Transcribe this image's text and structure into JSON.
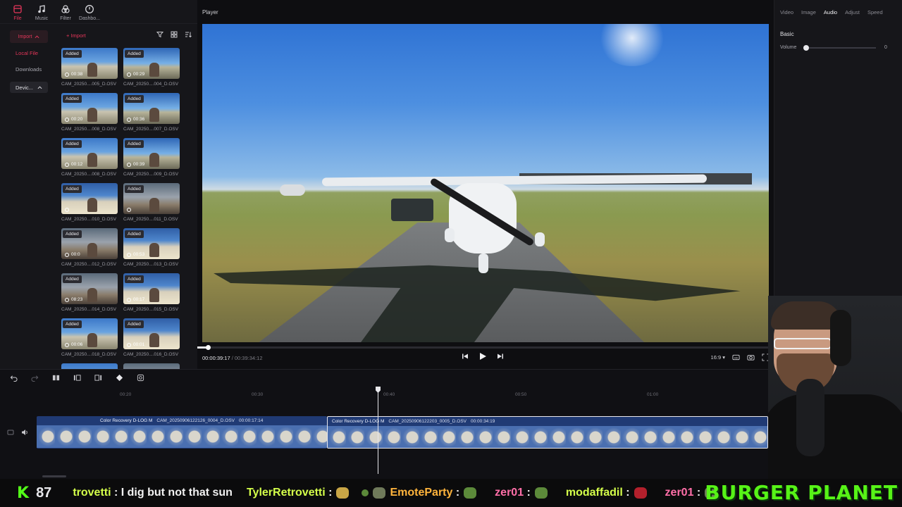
{
  "nav": {
    "items": [
      {
        "label": "File",
        "icon": "file-icon",
        "active": true
      },
      {
        "label": "Music",
        "icon": "music-note-icon",
        "active": false
      },
      {
        "label": "Filter",
        "icon": "filter-circles-icon",
        "active": false
      },
      {
        "label": "Dashbo...",
        "icon": "dashboard-clock-icon",
        "active": false
      }
    ]
  },
  "rail": {
    "import_label": "Import",
    "local_file": "Local File",
    "downloads": "Downloads",
    "devices": "Devic..."
  },
  "media": {
    "import_label": "+ Import",
    "clips": [
      {
        "badge": "Added",
        "duration": "00:38",
        "name": "CAM_20250....005_D.OSV"
      },
      {
        "badge": "Added",
        "duration": "00:29",
        "name": "CAM_20250....004_D.OSV"
      },
      {
        "badge": "Added",
        "duration": "00:20",
        "name": "CAM_20250....008_D.OSV"
      },
      {
        "badge": "Added",
        "duration": "00:36",
        "name": "CAM_20250....007_D.OSV"
      },
      {
        "badge": "Added",
        "duration": "00:12",
        "name": "CAM_20250....008_D.OSV"
      },
      {
        "badge": "Added",
        "duration": "00:39",
        "name": "CAM_20250....009_D.OSV"
      },
      {
        "badge": "Added",
        "duration": "",
        "name": "CAM_20250....010_D.OSV"
      },
      {
        "badge": "Added",
        "duration": "",
        "name": "CAM_20250....011_D.OSV"
      },
      {
        "badge": "Added",
        "duration": "00:0",
        "name": "CAM_20250....012_D.OSV"
      },
      {
        "badge": "Added",
        "duration": "00:53",
        "name": "CAM_20250....013_D.OSV"
      },
      {
        "badge": "Added",
        "duration": "08:23",
        "name": "CAM_20250....014_D.OSV"
      },
      {
        "badge": "Added",
        "duration": "00:17",
        "name": "CAM_20250....015_D.OSV"
      },
      {
        "badge": "Added",
        "duration": "00:06",
        "name": "CAM_20250....018_D.OSV"
      },
      {
        "badge": "Added",
        "duration": "00:01",
        "name": "CAM_20250....016_D.OSV"
      }
    ]
  },
  "player": {
    "title": "Player",
    "current_time": "00:00:39:17",
    "total_time": "/ 00:39:34:12",
    "progress_fraction": 0.017,
    "aspect": "16:9"
  },
  "rpanel": {
    "tabs": [
      {
        "label": "Video",
        "active": false
      },
      {
        "label": "Image",
        "active": false
      },
      {
        "label": "Audio",
        "active": true
      },
      {
        "label": "Adjust",
        "active": false
      },
      {
        "label": "Speed",
        "active": false
      }
    ],
    "section": "Basic",
    "volume_label": "Volume",
    "volume_value": "0"
  },
  "timeline": {
    "ticks": [
      "00:20",
      "00:30",
      "00:40",
      "00:50",
      "01:00"
    ],
    "clips": [
      {
        "tag": "Color Recovery D-LOG M",
        "name": "CAM_20250906122126_0004_D.OSV",
        "duration": "00:00:17:14"
      },
      {
        "tag": "Color Recovery D-LOG M",
        "name": "CAM_20250906122203_0005_D.OSV",
        "duration": "00:00:34:19"
      }
    ]
  },
  "ticker": {
    "k": "K",
    "count": "87",
    "messages": [
      {
        "user": "trovetti",
        "text": "I dig but not that sun",
        "color": "lime"
      },
      {
        "user": "TylerRetrovetti",
        "text": "",
        "color": "lime"
      },
      {
        "user": "EmoteParty",
        "text": "",
        "color": "orange"
      },
      {
        "user": "zer01",
        "text": "",
        "color": "pink"
      },
      {
        "user": "modaffadil",
        "text": "",
        "color": "lime"
      },
      {
        "user": "zer01",
        "text": "",
        "color": "pink"
      }
    ],
    "brand": "BURGER PLANET"
  },
  "colors": {
    "accent": "#e5365a",
    "clip": "#203a74",
    "kick_green": "#53fc18"
  }
}
